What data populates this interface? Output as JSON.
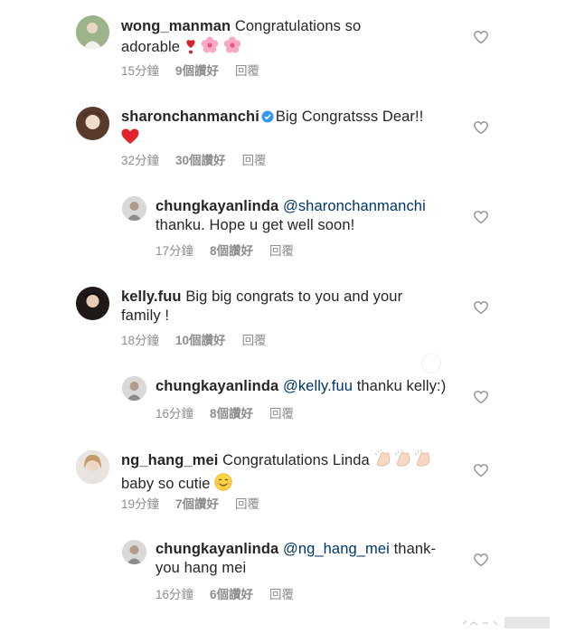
{
  "comments": [
    {
      "user": "wong_manman",
      "text": "Congratulations so adorable",
      "time": "15分鐘",
      "likes": "9個讚好",
      "reply": "回覆"
    },
    {
      "user": "sharonchanmanchi",
      "text": "Big Congratsss Dear!!",
      "time": "32分鐘",
      "likes": "30個讚好",
      "reply": "回覆"
    },
    {
      "user": "chungkayanlinda",
      "mention": "@sharonchanmanchi",
      "text": "thanku. Hope u get well soon!",
      "time": "17分鐘",
      "likes": "8個讚好",
      "reply": "回覆"
    },
    {
      "user": "kelly.fuu",
      "text": "Big big congrats to you and your family !",
      "time": "18分鐘",
      "likes": "10個讚好",
      "reply": "回覆"
    },
    {
      "user": "chungkayanlinda",
      "mention": "@kelly.fuu",
      "text": "thanku kelly:)",
      "time": "16分鐘",
      "likes": "8個讚好",
      "reply": "回覆"
    },
    {
      "user": "ng_hang_mei",
      "text": "Congratulations Linda",
      "text2": "baby so cutie",
      "time": "19分鐘",
      "likes": "7個讚好",
      "reply": "回覆"
    },
    {
      "user": "chungkayanlinda",
      "mention": "@ng_hang_mei",
      "text": "thank- you hang mei",
      "time": "16分鐘",
      "likes": "6個讚好",
      "reply": "回覆"
    }
  ],
  "icons": {
    "heart": "heart-outline-icon",
    "verified": "verified-badge-icon"
  },
  "colors": {
    "meta": "#8e8e8e",
    "mention": "#003569",
    "verified": "#3897f0"
  }
}
